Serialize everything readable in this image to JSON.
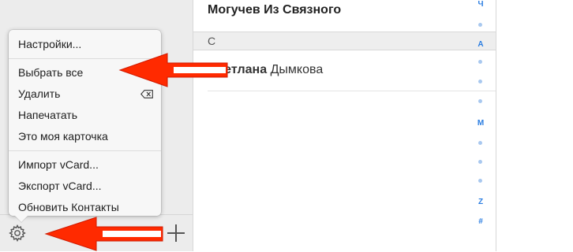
{
  "menu": {
    "items": [
      {
        "label": "Настройки..."
      },
      {
        "separator": true
      },
      {
        "label": "Выбрать все"
      },
      {
        "label": "Удалить",
        "shortcut_icon": "delete-key-icon"
      },
      {
        "label": "Напечатать"
      },
      {
        "label": "Это моя карточка"
      },
      {
        "separator": true
      },
      {
        "label": "Импорт vCard..."
      },
      {
        "label": "Экспорт vCard..."
      },
      {
        "label": "Обновить Контакты"
      }
    ]
  },
  "toolbar": {
    "settings_icon": "gear-icon",
    "add_icon": "plus-icon"
  },
  "list": {
    "first_contact": "Могучев Из Связного",
    "section_letter": "С",
    "contact": {
      "first": "Светлана",
      "last": "Дымкова"
    }
  },
  "index": [
    "Ч",
    "•",
    "A",
    "•",
    "•",
    "•",
    "M",
    "•",
    "•",
    "•",
    "Z",
    "#"
  ],
  "annotation_color": "#ff2a00"
}
